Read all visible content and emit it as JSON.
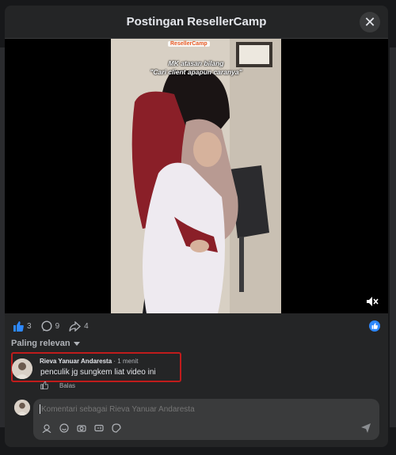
{
  "dialog": {
    "title": "Postingan ResellerCamp",
    "close_glyph": "✕"
  },
  "video": {
    "brand": "ResellerCamp",
    "overlay_line1": "MK atasan bilang",
    "overlay_line2": "\"Cari client apapun caranya\""
  },
  "reactions": {
    "likes": "3",
    "comments": "9",
    "shares": "4"
  },
  "sort": {
    "label": "Paling relevan"
  },
  "comment": {
    "author": "Rieva Yanuar Andaresta",
    "time": "· 1 menit",
    "text": "penculik jg sungkem liat video ini",
    "reply_label": "Balas"
  },
  "composer": {
    "placeholder": "Komentari sebagai Rieva Yanuar Andaresta"
  },
  "colors": {
    "accent": "#2d88ff",
    "highlight_border": "#c01c1c",
    "panel": "#242526"
  }
}
